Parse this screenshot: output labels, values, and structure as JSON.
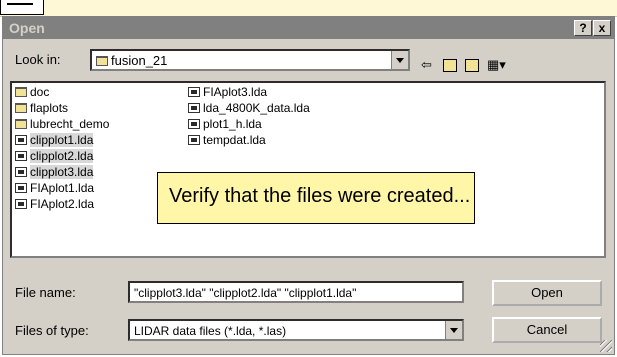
{
  "dialog": {
    "title": "Open",
    "help_button": "?",
    "close_button": "x"
  },
  "look_in": {
    "label": "Look in:",
    "value": "fusion_21"
  },
  "toolbar": {
    "icons": [
      "back-icon",
      "up-folder-icon",
      "new-folder-icon",
      "view-menu-icon"
    ]
  },
  "files": {
    "col1": [
      {
        "name": "doc",
        "kind": "folder",
        "selected": false
      },
      {
        "name": "flaplots",
        "kind": "folder",
        "selected": false
      },
      {
        "name": "lubrecht_demo",
        "kind": "folder",
        "selected": false
      },
      {
        "name": "clipplot1.lda",
        "kind": "file",
        "selected": true
      },
      {
        "name": "clipplot2.lda",
        "kind": "file",
        "selected": true
      },
      {
        "name": "clipplot3.lda",
        "kind": "file",
        "selected": true
      },
      {
        "name": "FIAplot1.lda",
        "kind": "file",
        "selected": false
      },
      {
        "name": "FIAplot2.lda",
        "kind": "file",
        "selected": false
      }
    ],
    "col2": [
      {
        "name": "FIAplot3.lda",
        "kind": "file",
        "selected": false
      },
      {
        "name": "lda_4800K_data.lda",
        "kind": "file",
        "selected": false
      },
      {
        "name": "plot1_h.lda",
        "kind": "file",
        "selected": false
      },
      {
        "name": "tempdat.lda",
        "kind": "file",
        "selected": false
      }
    ]
  },
  "callout": {
    "text": "Verify that the files were created..."
  },
  "file_name": {
    "label": "File name:",
    "value": "\"clipplot3.lda\" \"clipplot2.lda\" \"clipplot1.lda\""
  },
  "file_type": {
    "label": "Files of type:",
    "value": "LIDAR data files (*.lda, *.las)"
  },
  "buttons": {
    "open": "Open",
    "cancel": "Cancel"
  }
}
